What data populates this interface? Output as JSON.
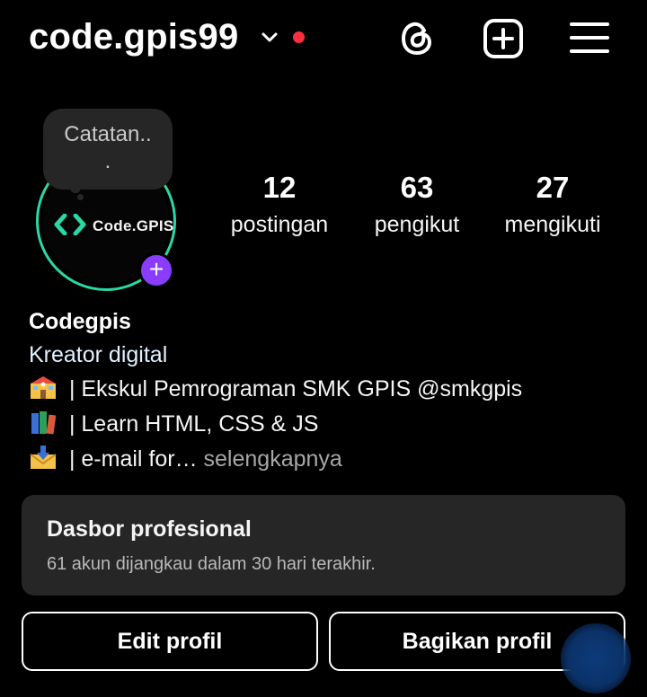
{
  "header": {
    "username": "code.gpis99",
    "icons": [
      "chevron-down-icon",
      "notification-dot",
      "threads-icon",
      "add-post-icon",
      "menu-icon"
    ],
    "dot_color": "#ff2d3d"
  },
  "profile": {
    "note": "Catatan..\n.",
    "avatar_logo_text": "Code.GPIS",
    "ring_color": "#2ad7a5",
    "add_story_color": "#8a3dff"
  },
  "stats": {
    "posts": {
      "value": "12",
      "label": "postingan"
    },
    "followers": {
      "value": "63",
      "label": "pengikut"
    },
    "following": {
      "value": "27",
      "label": "mengikuti"
    }
  },
  "bio": {
    "name": "Codegpis",
    "category": "Kreator digital",
    "lines": [
      {
        "emoji": "school-emoji",
        "text": " | Ekskul Pemrograman SMK GPIS @smkgpis"
      },
      {
        "emoji": "books-emoji",
        "text": " | Learn HTML, CSS & JS"
      },
      {
        "emoji": "inbox-emoji",
        "text": " | e-mail for…"
      }
    ],
    "more": " selengkapnya"
  },
  "dashboard": {
    "title": "Dasbor profesional",
    "subtitle": "61 akun dijangkau dalam 30 hari terakhir."
  },
  "buttons": {
    "edit": "Edit profil",
    "share": "Bagikan profil"
  }
}
